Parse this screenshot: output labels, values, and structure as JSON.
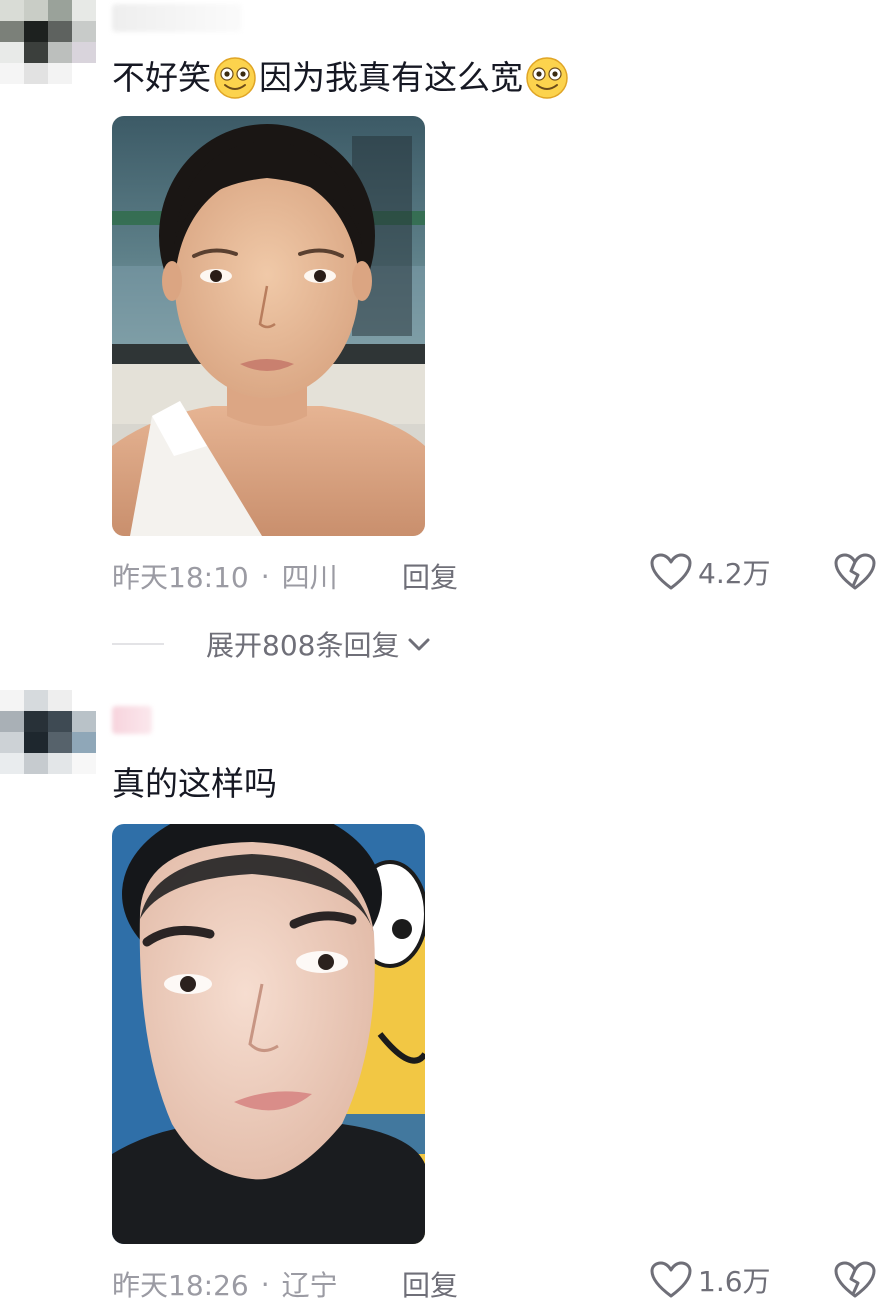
{
  "comments": [
    {
      "text_part1": "不好笑",
      "text_part2": "因为我真有这么宽",
      "emoji_icon": "flushed-smile-emoji",
      "time": "昨天18:10",
      "location": "四川",
      "reply_label": "回复",
      "likes": "4.2万"
    },
    {
      "text": "真的这样吗",
      "time": "昨天18:26",
      "location": "辽宁",
      "reply_label": "回复",
      "likes": "1.6万"
    }
  ],
  "expand_replies": {
    "label": "展开808条回复"
  },
  "separator": "·",
  "colors": {
    "accent_text": "#161823",
    "meta_text": "#9b9ba3",
    "icon": "#6f6f78"
  }
}
